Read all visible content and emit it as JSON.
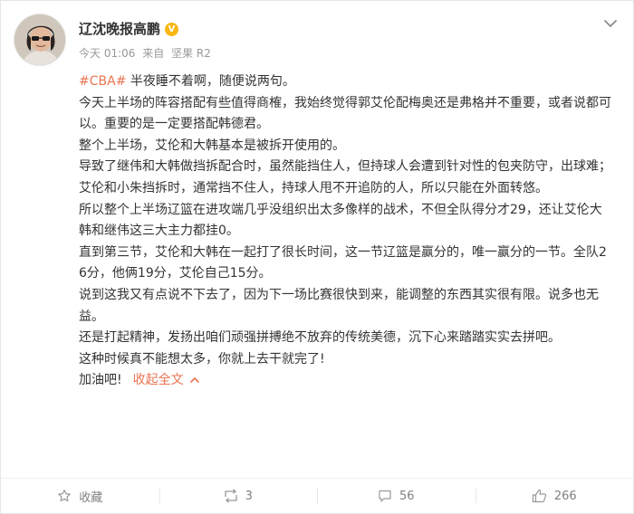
{
  "post": {
    "author": "辽沈晚报高鹏",
    "verified_badge": "V",
    "time": "今天 01:06",
    "source_prefix": "来自",
    "source": "坚果 R2",
    "hashtag": "#CBA#",
    "lines": [
      " 半夜睡不着啊，随便说两句。",
      "今天上半场的阵容搭配有些值得商榷，我始终觉得郭艾伦配梅奥还是弗格并不重要，或者说都可以。重要的是一定要搭配韩德君。",
      "整个上半场，艾伦和大韩基本是被拆开使用的。",
      "导致了继伟和大韩做挡拆配合时，虽然能挡住人，但持球人会遭到针对性的包夹防守，出球难；艾伦和小朱挡拆时，通常挡不住人，持球人甩不开追防的人，所以只能在外面转悠。",
      "所以整个上半场辽篮在进攻端几乎没组织出太多像样的战术，不但全队得分才29，还让艾伦大韩和继伟这三大主力都挂0。",
      "直到第三节，艾伦和大韩在一起打了很长时间，这一节辽篮是赢分的，唯一赢分的一节。全队26分，他俩19分，艾伦自己15分。",
      "说到这我又有点说不下去了，因为下一场比赛很快到来，能调整的东西其实很有限。说多也无益。",
      "还是打起精神，发扬出咱们顽强拼搏绝不放弃的传统美德，沉下心来踏踏实实去拼吧。",
      "这种时候真不能想太多，你就上去干就完了!",
      "加油吧!"
    ],
    "collapse_label": "收起全文"
  },
  "actions": {
    "favorite_label": "收藏",
    "repost_count": "3",
    "comment_count": "56",
    "like_count": "266"
  },
  "colors": {
    "accent": "#eb7350",
    "text": "#333333",
    "meta": "#999999",
    "verified": "#f9b712"
  },
  "icons": [
    "avatar",
    "verified-badge-icon",
    "chevron-down-icon",
    "chevron-up-icon",
    "star-icon",
    "repost-icon",
    "comment-icon",
    "thumbs-up-icon"
  ]
}
